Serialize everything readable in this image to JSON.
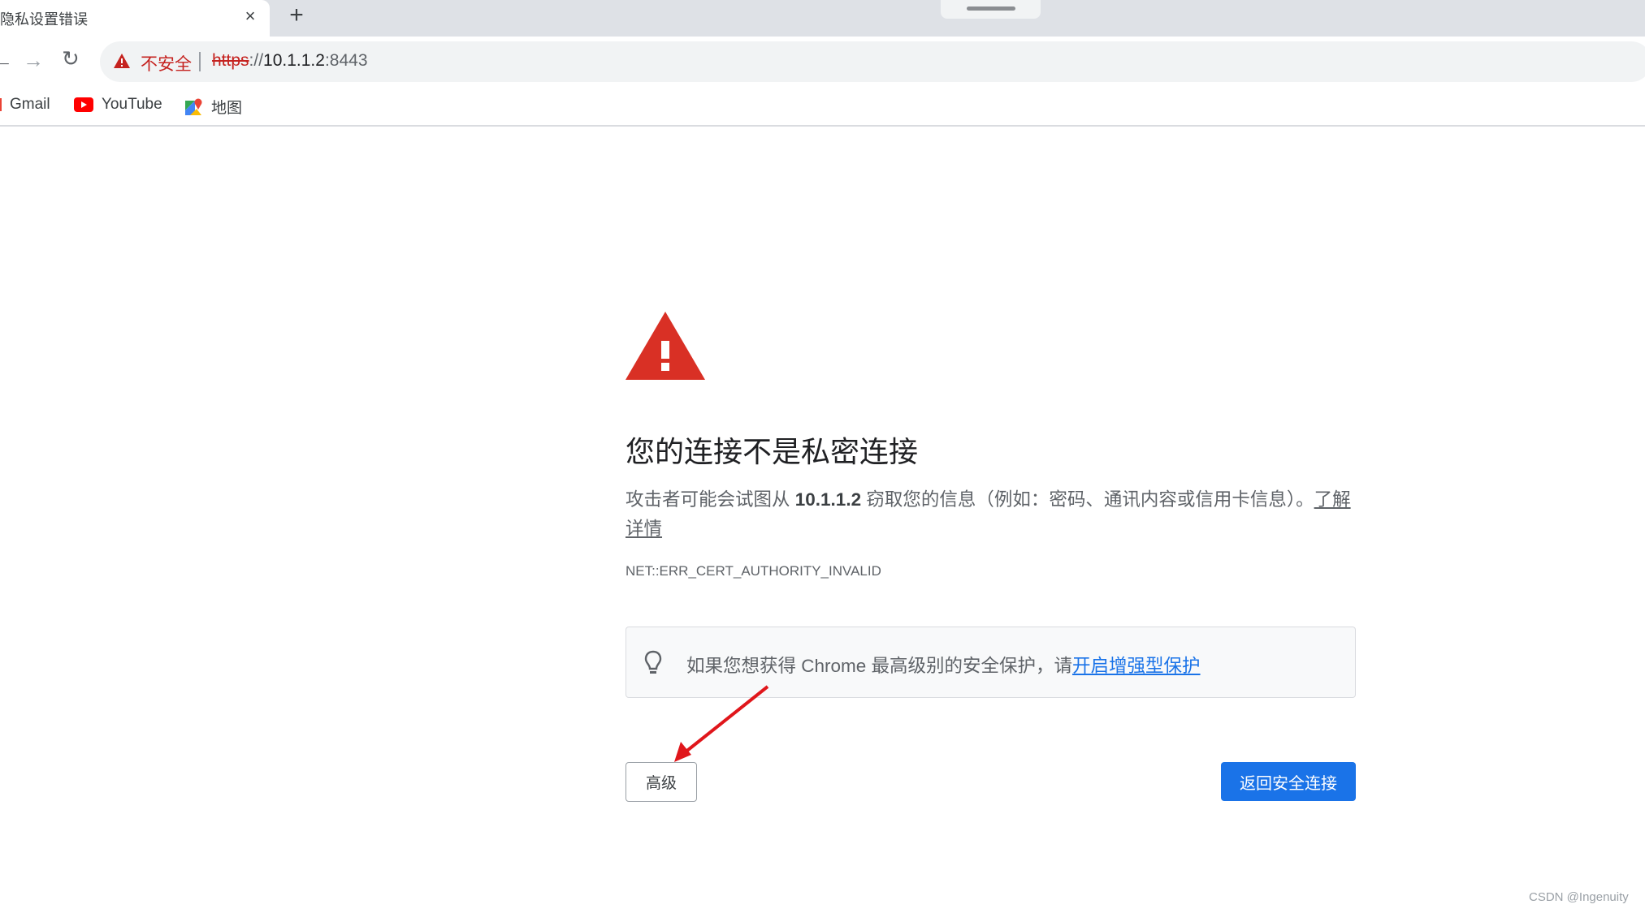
{
  "tab": {
    "title": "隐私设置错误",
    "close": "×",
    "new_tab": "+"
  },
  "omnibox": {
    "security_label": "不安全",
    "url_scheme": "https",
    "url_sep": "://",
    "url_host": "10.1.1.2",
    "url_port": ":8443"
  },
  "bookmarks": [
    {
      "label": "Gmail",
      "icon": "gmail-icon"
    },
    {
      "label": "YouTube",
      "icon": "youtube-icon"
    },
    {
      "label": "地图",
      "icon": "maps-icon"
    }
  ],
  "interstitial": {
    "heading": "您的连接不是私密连接",
    "desc_before": "攻击者可能会试图从 ",
    "desc_host": "10.1.1.2",
    "desc_after": " 窃取您的信息（例如：密码、通讯内容或信用卡信息）。",
    "learn_more": "了解详情",
    "error_code": "NET::ERR_CERT_AUTHORITY_INVALID",
    "tip_text": "如果您想获得 Chrome 最高级别的安全保护，请",
    "tip_link": "开启增强型保护",
    "advanced_button": "高级",
    "back_button": "返回安全连接"
  },
  "watermark": "CSDN @Ingenuity",
  "colors": {
    "warning_red": "#d93025",
    "accent_blue": "#1a73e8",
    "annotation_arrow": "#e0161b"
  }
}
